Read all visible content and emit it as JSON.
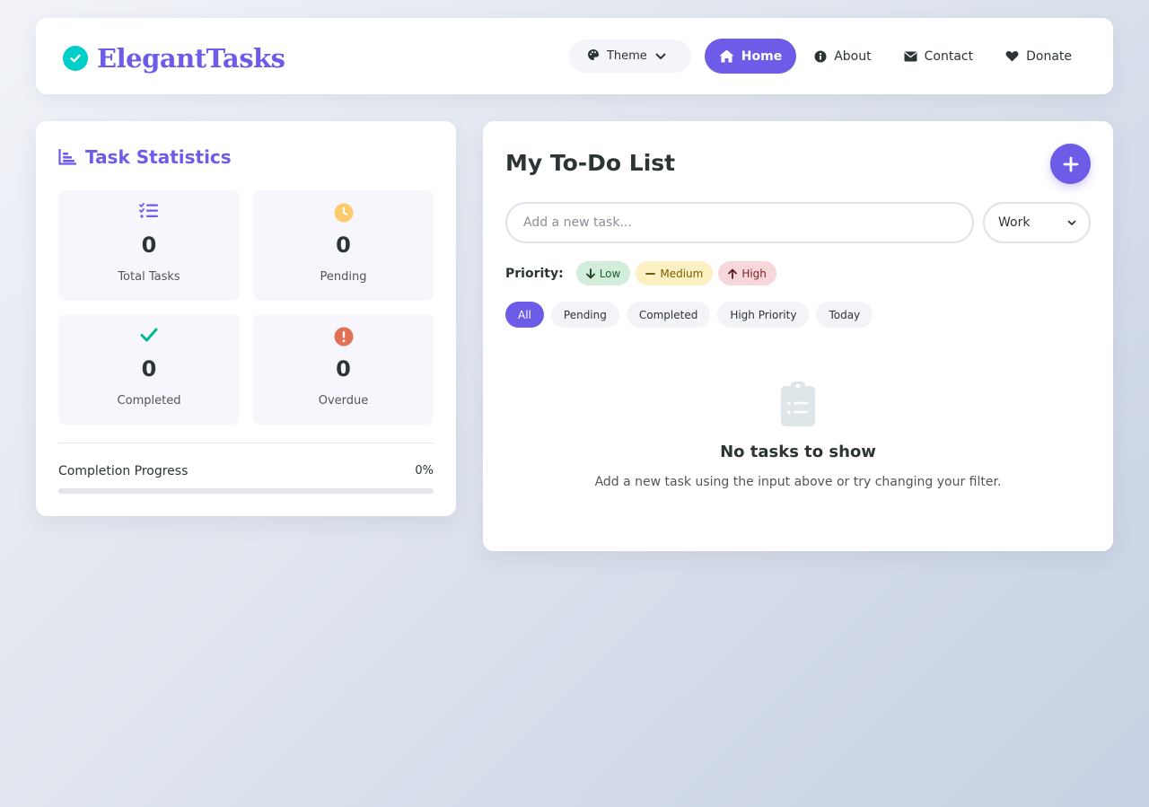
{
  "brand": {
    "name": "ElegantTasks"
  },
  "nav": {
    "theme_label": "Theme",
    "links": [
      {
        "label": "Home",
        "icon": "home-icon",
        "active": true
      },
      {
        "label": "About",
        "icon": "info-icon"
      },
      {
        "label": "Contact",
        "icon": "envelope-icon"
      },
      {
        "label": "Donate",
        "icon": "heart-icon"
      }
    ]
  },
  "stats": {
    "title": "Task Statistics",
    "items": [
      {
        "value": "0",
        "label": "Total Tasks",
        "icon": "list-check-icon"
      },
      {
        "value": "0",
        "label": "Pending",
        "icon": "clock-icon"
      },
      {
        "value": "0",
        "label": "Completed",
        "icon": "check-icon"
      },
      {
        "value": "0",
        "label": "Overdue",
        "icon": "exclamation-icon"
      }
    ],
    "progress_label": "Completion Progress",
    "progress_value": "0%",
    "progress_fraction": 0
  },
  "todo": {
    "title": "My To-Do List",
    "input_placeholder": "Add a new task...",
    "category_selected": "Work",
    "priority_label": "Priority:",
    "priorities": [
      {
        "label": "Low"
      },
      {
        "label": "Medium"
      },
      {
        "label": "High"
      }
    ],
    "filters": [
      {
        "label": "All",
        "active": true
      },
      {
        "label": "Pending"
      },
      {
        "label": "Completed"
      },
      {
        "label": "High Priority"
      },
      {
        "label": "Today"
      }
    ],
    "empty_title": "No tasks to show",
    "empty_text": "Add a new task using the input above or try changing your filter."
  },
  "colors": {
    "primary": "#6c5ce7",
    "teal": "#00cec9",
    "pending": "#fdcb6e",
    "completed": "#00b894",
    "overdue": "#e17055"
  }
}
